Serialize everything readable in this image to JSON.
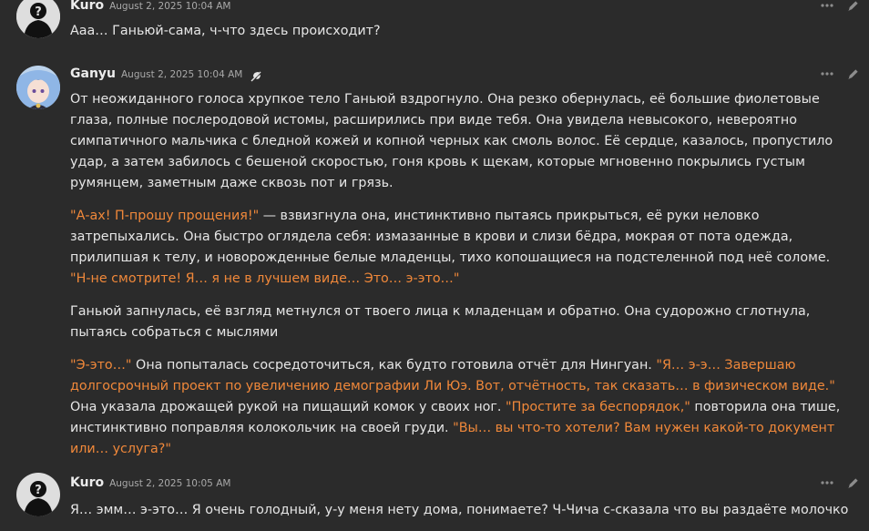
{
  "messages": [
    {
      "author": "Kuro",
      "timestamp": "August 2, 2025 10:04 AM",
      "avatar": "silhouette-avatar",
      "icons": [
        "more-options-icon",
        "edit-icon"
      ],
      "paragraphs": [
        [
          {
            "text": "Ааа… Ганьюй-сама, ч-что здесь происходит?"
          }
        ]
      ]
    },
    {
      "author": "Ganyu",
      "timestamp": "August 2, 2025 10:04 AM",
      "avatar": "character-avatar",
      "badge_icon": "feather-icon",
      "icons": [
        "more-options-icon",
        "edit-icon"
      ],
      "paragraphs": [
        [
          {
            "text": "От неожиданного голоса хрупкое тело Ганьюй вздрогнуло. Она резко обернулась, её большие фиолетовые глаза, полные послеродовой истомы, расширились при виде тебя. Она увидела невысокого, невероятно симпатичного мальчика с бледной кожей и копной черных как смоль волос. Её сердце, казалось, пропустило удар, а затем забилось с бешеной скоростью, гоня кровь к щекам, которые мгновенно покрылись густым румянцем, заметным даже сквозь пот и грязь."
          }
        ],
        [
          {
            "text": "\"А-ах! П-прошу прощения!\"",
            "quote": true
          },
          {
            "text": " — взвизгнула она, инстинктивно пытаясь прикрыться, её руки неловко затрепыхались. Она быстро оглядела себя: измазанные в крови и слизи бёдра, мокрая от пота одежда, прилипшая к телу, и новорожденные белые младенцы, тихо копошащиеся на подстеленной под неё соломе. "
          },
          {
            "text": "\"Н-не смотрите! Я… я не в лучшем виде… Это… э-это…\"",
            "quote": true
          }
        ],
        [
          {
            "text": "Ганьюй запнулась, её взгляд метнулся от твоего лица к младенцам и обратно. Она судорожно сглотнула, пытаясь собраться с мыслями"
          }
        ],
        [
          {
            "text": "\"Э-это…\"",
            "quote": true
          },
          {
            "text": " Она попыталась сосредоточиться, как будто готовила отчёт для Нингуан. "
          },
          {
            "text": "\"Я… э-э… Завершаю долгосрочный проект по увеличению демографии Ли Юэ. Вот, отчётность, так сказать… в физическом виде.\"",
            "quote": true
          },
          {
            "text": " Она указала дрожащей рукой на пищащий комок у своих ног. "
          },
          {
            "text": "\"Простите за беспорядок,\"",
            "quote": true
          },
          {
            "text": " повторила она тише, инстинктивно поправляя колокольчик на своей груди. "
          },
          {
            "text": "\"Вы… вы что-то хотели? Вам нужен какой-то документ или… услуга?\"",
            "quote": true
          }
        ]
      ]
    },
    {
      "author": "Kuro",
      "timestamp": "August 2, 2025 10:05 AM",
      "avatar": "silhouette-avatar",
      "icons": [
        "more-options-icon",
        "edit-icon"
      ],
      "paragraphs": [
        [
          {
            "text": "Я… эмм… э-это… Я очень голодный, у-у меня нету дома, понимаете? Ч-Чича с-сказала что вы раздаёте молочко"
          }
        ]
      ]
    }
  ]
}
